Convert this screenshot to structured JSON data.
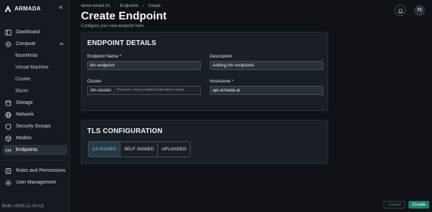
{
  "brand": {
    "name": "ARMADA"
  },
  "sidebar": {
    "items": [
      {
        "label": "Dashboard",
        "icon": "dashboard-icon"
      },
      {
        "label": "Compute",
        "icon": "compute-icon",
        "expanded": true
      },
      {
        "label": "BareMetal",
        "sub": true
      },
      {
        "label": "Virtual Machine",
        "sub": true
      },
      {
        "label": "Cluster",
        "sub": true
      },
      {
        "label": "Slurm",
        "sub": true
      },
      {
        "label": "Storage",
        "icon": "storage-icon"
      },
      {
        "label": "Network",
        "icon": "network-icon"
      },
      {
        "label": "Security Groups",
        "icon": "shield-icon"
      },
      {
        "label": "Models",
        "icon": "models-icon"
      },
      {
        "label": "Endpoints",
        "icon": "endpoints-icon",
        "active": true
      },
      {
        "label": "Roles and Permissions",
        "icon": "roles-icon"
      },
      {
        "label": "User Management",
        "icon": "user-management-icon"
      }
    ],
    "build": "Build: v2025.12.16-rc3"
  },
  "breadcrumb": {
    "tenant": "demo-tenant-01",
    "section": "Endpoints",
    "page": "Create"
  },
  "header": {
    "title": "Create Endpoint",
    "subtitle": "Configure your new endpoint here",
    "avatar_initials": "T1"
  },
  "endpoint_details": {
    "title": "ENDPOINT DETAILS",
    "name_label": "Endpoint Name *",
    "name_value": "llm-endpoint",
    "description_label": "Description",
    "description_value": "Adding llm endpoints",
    "cluster_label": "Cluster",
    "cluster_value": "llm-cluster",
    "cluster_hint": "Provision a Ray-enabled Kubernetes cluster",
    "hostname_label": "Hostname *",
    "hostname_value": "api.armada.ai"
  },
  "tls": {
    "title": "TLS CONFIGURATION",
    "options": [
      "CA SIGNED",
      "SELF SIGNED",
      "UPLOADED"
    ],
    "selected": "CA SIGNED"
  },
  "actions": {
    "cancel": "Cancel",
    "create": "Create"
  },
  "colors": {
    "accent": "#6cc8e6",
    "primary_button": "#1f7f6e",
    "background": "#0f1318",
    "card": "#1a1f25"
  }
}
